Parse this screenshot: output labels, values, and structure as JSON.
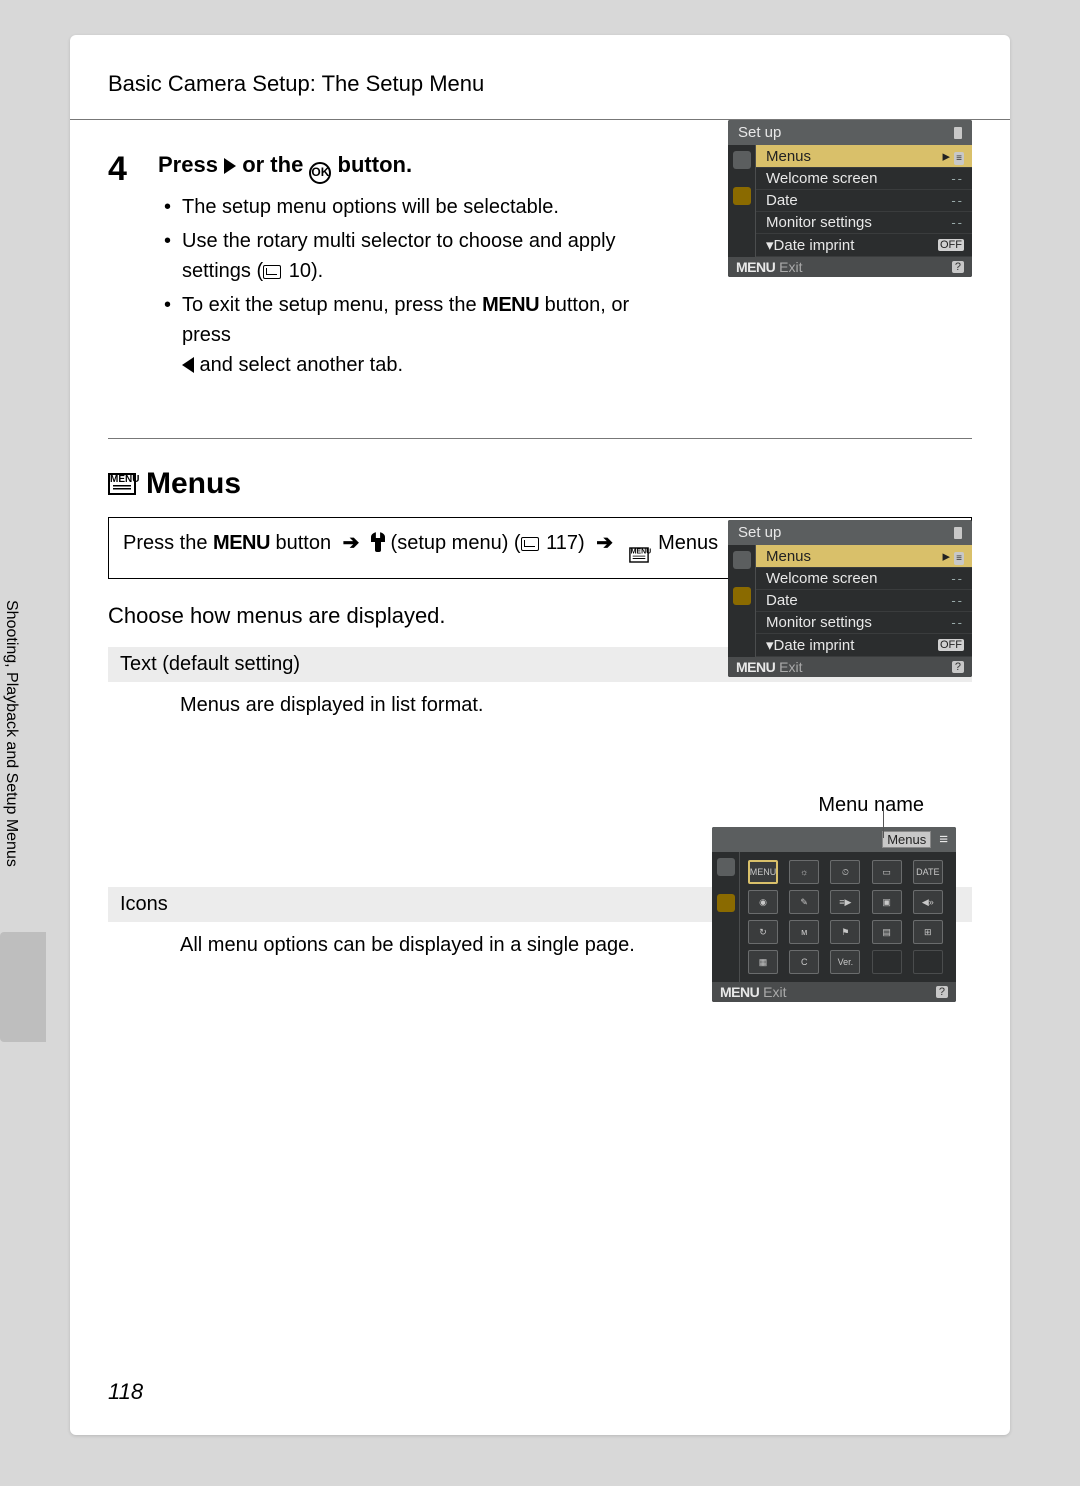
{
  "header": "Basic Camera Setup: The Setup Menu",
  "vertical_text": "Shooting, Playback and Setup Menus",
  "step": {
    "number": "4",
    "title_prefix": "Press ",
    "title_mid": " or the ",
    "title_suffix": " button.",
    "bullets": [
      "The setup menu options will be selectable.",
      "Use the rotary multi selector to choose and apply settings (",
      "To exit the setup menu, press the ",
      " and select another tab."
    ],
    "ref1": " 10).",
    "menu_word": "MENU",
    "bullet3_tail": " button, or press "
  },
  "section": {
    "title": "Menus",
    "nav_prefix": "Press the ",
    "nav_menu": "MENU",
    "nav_mid1": " button ",
    "nav_setup": " (setup menu) (",
    "nav_ref": " 117) ",
    "nav_tail": " Menus",
    "intro": "Choose how menus are displayed.",
    "option1_title": "Text (default setting)",
    "option1_desc": "Menus are displayed in list format.",
    "option2_title": "Icons",
    "option2_desc": "All menu options can be displayed in a single page.",
    "menu_name_label": "Menu name"
  },
  "lcd": {
    "title": "Set up",
    "rows": [
      {
        "label": "Menus",
        "value_type": "arrow-list",
        "selected": true
      },
      {
        "label": "Welcome screen",
        "value_type": "dashes"
      },
      {
        "label": "Date",
        "value_type": "dashes"
      },
      {
        "label": "Monitor settings",
        "value_type": "dashes"
      },
      {
        "label": "Date imprint",
        "value_type": "off",
        "value": "OFF"
      }
    ],
    "exit_menu": "MENU",
    "exit": "Exit",
    "help": "?"
  },
  "lcd_icons": {
    "tag": "Menus",
    "grid": [
      [
        "MENU",
        "☼",
        "⏲",
        "▭",
        "DATE"
      ],
      [
        "◉",
        "✎",
        "≡▶",
        "▣",
        "◀»"
      ],
      [
        "↻",
        "ᴍ",
        "⚑",
        "▤",
        "⊞"
      ],
      [
        "▦",
        "C",
        "Ver.",
        "",
        ""
      ]
    ]
  },
  "page_number": "118"
}
